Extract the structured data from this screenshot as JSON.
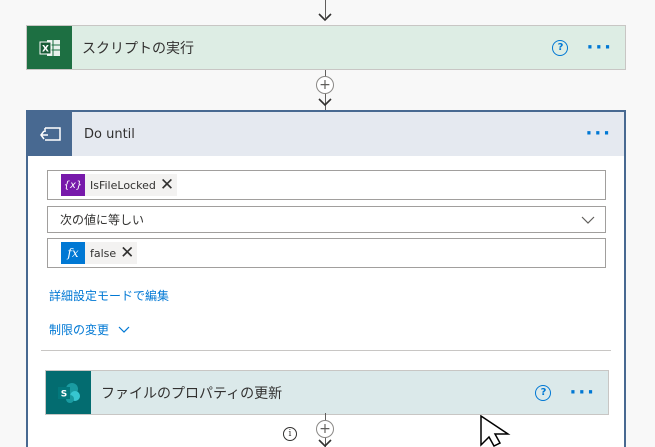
{
  "top_action": {
    "title": "スクリプトの実行",
    "icon": "excel-icon",
    "color": "#1d6f42"
  },
  "do_until": {
    "title": "Do until",
    "icon": "loop-icon",
    "condition": {
      "left_token": {
        "label": "IsFileLocked",
        "icon": "variable-icon",
        "icon_text": "{x}",
        "color": "#7719aa"
      },
      "operator": "次の値に等しい",
      "right_token": {
        "label": "false",
        "icon": "expression-icon",
        "icon_text": "fx",
        "color": "#0078d4"
      }
    },
    "advanced_link": "詳細設定モードで編集",
    "limits_link": "制限の変更"
  },
  "inner_action": {
    "title": "ファイルのプロパティの更新",
    "icon": "sharepoint-icon",
    "color": "#036c70"
  },
  "more_label": "···",
  "help_label": "?",
  "add_label": "+",
  "info_label": "i"
}
